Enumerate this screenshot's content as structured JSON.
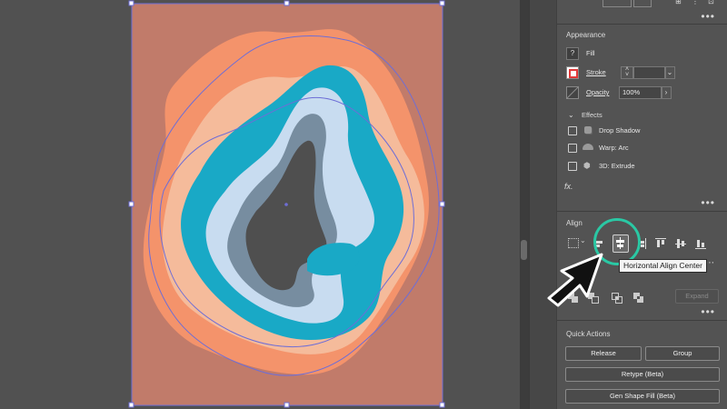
{
  "canvas": {
    "artboard_bg": "#c17b6a",
    "colors": {
      "coral": "#f4936b",
      "peach": "#f5bb9b",
      "teal": "#19a9c6",
      "light_blue": "#c8dcf0",
      "gray": "#778da0",
      "dark": "#4f4f4f",
      "outline": "#6e6ed6"
    }
  },
  "appearance": {
    "title": "Appearance",
    "fill_label": "Fill",
    "fill_icon": "question-icon",
    "stroke_label": "Stroke",
    "opacity_label": "Opacity",
    "opacity_value": "100%",
    "effects_title": "Effects",
    "effects": [
      {
        "label": "Drop Shadow",
        "icon": "drop-shadow-icon"
      },
      {
        "label": "Warp: Arc",
        "icon": "warp-arc-icon"
      },
      {
        "label": "3D: Extrude",
        "icon": "extrude-3d-icon"
      }
    ],
    "fx_label": "fx."
  },
  "align": {
    "title": "Align",
    "tooltip": "Horizontal Align Center",
    "expand_label": "Expand"
  },
  "quick_actions": {
    "title": "Quick Actions",
    "release": "Release",
    "group": "Group",
    "retype": "Retype (Beta)",
    "gen_shape_fill": "Gen Shape Fill (Beta)"
  },
  "accent_colors": {
    "highlight_ring": "#2ac8a4",
    "stroke_swatch": "#e23a3a"
  }
}
